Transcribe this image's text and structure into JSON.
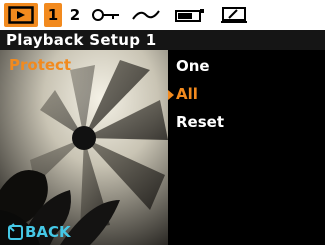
{
  "tabs": {
    "playback_icon": "playback-icon",
    "tab1_label": "1",
    "tab2_label": "2",
    "key_icon": "key-icon",
    "curve_icon": "wave-icon",
    "battery_icon": "battery-icon",
    "screen_icon": "screen-edit-icon"
  },
  "title": "Playback Setup 1",
  "left": {
    "setting_label": "Protect",
    "back_label": "BACK"
  },
  "options": [
    {
      "label": "One",
      "selected": false
    },
    {
      "label": "All",
      "selected": true
    },
    {
      "label": "Reset",
      "selected": false
    }
  ],
  "colors": {
    "accent": "#f28a1e",
    "back": "#45c8e6"
  }
}
